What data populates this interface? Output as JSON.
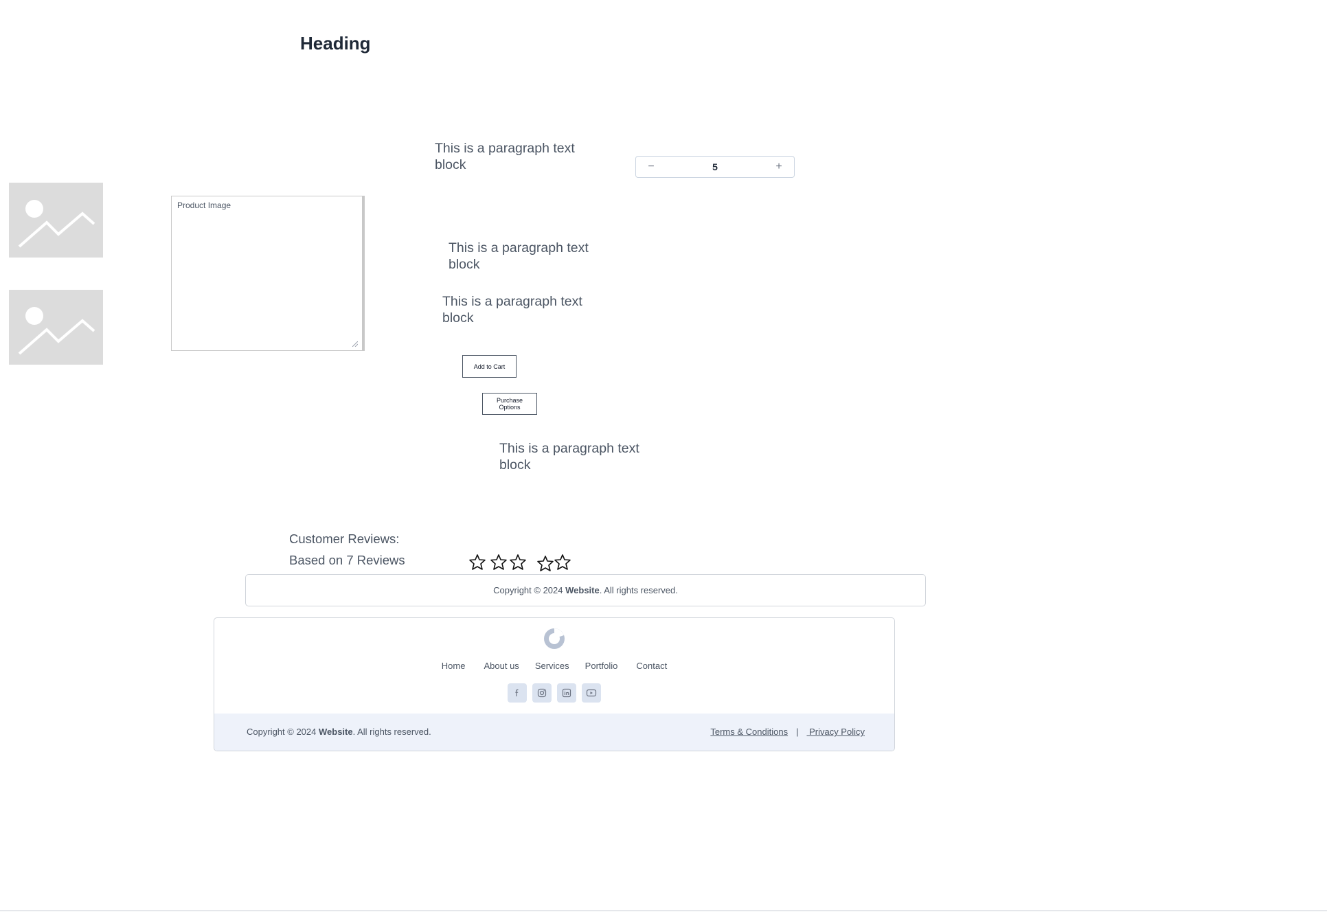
{
  "page": {
    "heading": "Heading",
    "paragraph_1": "This is a paragraph text block",
    "paragraph_2": "This is a paragraph text block",
    "paragraph_3": "This is a paragraph text block",
    "paragraph_4": "This is a paragraph text block"
  },
  "quantity": {
    "decrement": "−",
    "value": "5",
    "increment": "+"
  },
  "images": {
    "placeholder_icon": "image-placeholder-icon"
  },
  "product_image_field": {
    "value": "Product Image"
  },
  "buttons": {
    "add_to_cart": "Add to Cart",
    "purchase_options": "Purchase Options"
  },
  "reviews": {
    "title": "Customer Reviews:",
    "based_on": "Based on 7 Reviews",
    "rating": 0,
    "max_rating": 5
  },
  "copyright_bar": {
    "prefix": "Copyright © 2024 ",
    "site": "Website",
    "suffix": ". All rights reserved."
  },
  "footer": {
    "nav": [
      "Home",
      "About us",
      "Services",
      "Portfolio",
      "Contact"
    ],
    "social": [
      "facebook-icon",
      "instagram-icon",
      "linkedin-icon",
      "youtube-icon"
    ],
    "copyright_prefix": "Copyright © 2024 ",
    "copyright_site": "Website",
    "copyright_suffix": ". All rights reserved.",
    "terms": "Terms & Conditions",
    "separator": "|",
    "privacy": " Privacy Policy"
  },
  "colors": {
    "text": "#4b5563",
    "heading": "#1f2937",
    "border": "#d1d5db",
    "footer_bottom_bg": "#eef2fa",
    "social_bg": "#dbe3f0",
    "placeholder_bg": "#dcdcdc"
  }
}
